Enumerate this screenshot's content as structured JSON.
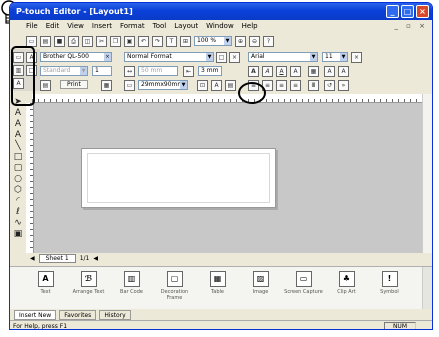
{
  "window": {
    "title": "P-touch Editor - [Layout1]"
  },
  "menu": [
    "File",
    "Edit",
    "View",
    "Insert",
    "Format",
    "Tool",
    "Layout",
    "Window",
    "Help"
  ],
  "toolbar": {
    "zoom": "100 %"
  },
  "properties": {
    "printer": "Brother QL-500",
    "style": "Standard",
    "copies": "1",
    "length": "50 mm",
    "margin": "3 mm",
    "paper_format": "Normal Format",
    "media": "29mmx90mm",
    "print_label": "Print",
    "font": "Arial",
    "font_size": "11"
  },
  "sheet": {
    "tab": "Sheet 1",
    "page": "1/1"
  },
  "panel_items": [
    "Text",
    "Arrange Text",
    "Bar Code",
    "Decoration Frame",
    "Table",
    "Image",
    "Screen Capture",
    "Clip Art",
    "Symbol"
  ],
  "bottom_tabs": [
    "Insert New",
    "Favorites",
    "History"
  ],
  "status": {
    "help": "For Help, press F1",
    "mode": "NUM"
  }
}
